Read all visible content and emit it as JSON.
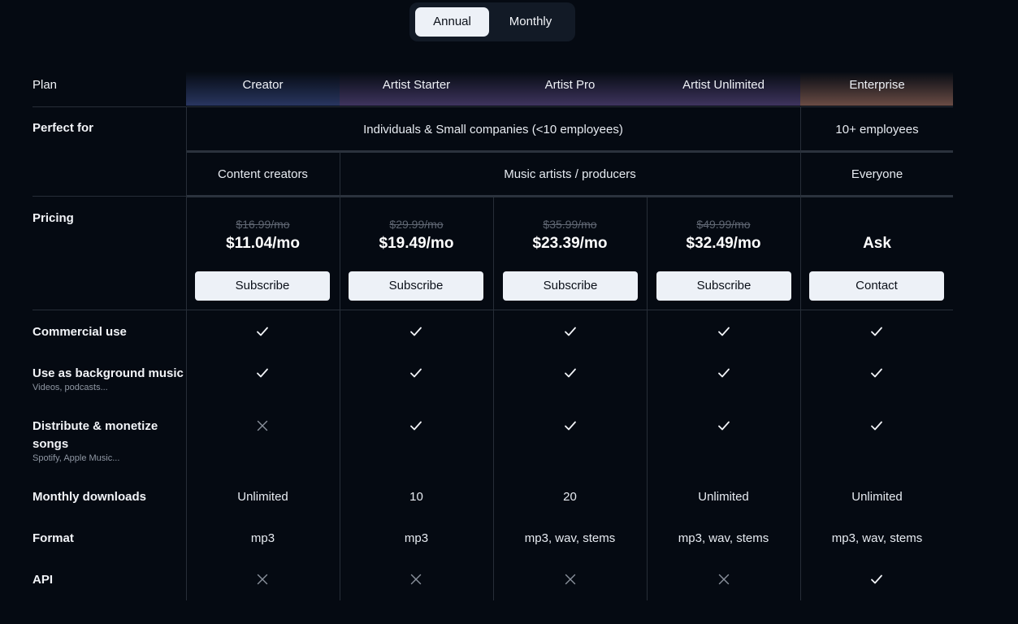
{
  "billing_toggle": {
    "annual": "Annual",
    "monthly": "Monthly",
    "selected": "Annual"
  },
  "labels": {
    "plan": "Plan",
    "perfect_for": "Perfect for",
    "pricing": "Pricing",
    "commercial_use": "Commercial use",
    "background_music": "Use as background music",
    "background_music_sub": "Videos, podcasts...",
    "distribute_line1": "Distribute & monetize",
    "distribute_line2": "songs",
    "distribute_sub": "Spotify, Apple Music...",
    "monthly_downloads": "Monthly downloads",
    "format": "Format",
    "api": "API"
  },
  "plans": [
    {
      "name": "Creator",
      "old_price": "$16.99/mo",
      "price": "$11.04/mo",
      "cta": "Subscribe",
      "downloads": "Unlimited",
      "format": "mp3"
    },
    {
      "name": "Artist Starter",
      "old_price": "$29.99/mo",
      "price": "$19.49/mo",
      "cta": "Subscribe",
      "downloads": "10",
      "format": "mp3"
    },
    {
      "name": "Artist Pro",
      "old_price": "$35.99/mo",
      "price": "$23.39/mo",
      "cta": "Subscribe",
      "downloads": "20",
      "format": "mp3, wav, stems"
    },
    {
      "name": "Artist Unlimited",
      "old_price": "$49.99/mo",
      "price": "$32.49/mo",
      "cta": "Subscribe",
      "downloads": "Unlimited",
      "format": "mp3, wav, stems"
    },
    {
      "name": "Enterprise",
      "old_price": "",
      "price": "Ask",
      "cta": "Contact",
      "downloads": "Unlimited",
      "format": "mp3, wav, stems"
    }
  ],
  "perfect_for": {
    "audience_small": "Individuals & Small companies (<10 employees)",
    "audience_large": "10+ employees",
    "creator_segment": "Content creators",
    "artist_segment": "Music artists / producers",
    "enterprise_segment": "Everyone"
  },
  "features": {
    "commercial_use": [
      true,
      true,
      true,
      true,
      true
    ],
    "background_music": [
      true,
      true,
      true,
      true,
      true
    ],
    "distribute": [
      false,
      true,
      true,
      true,
      true
    ],
    "api": [
      false,
      false,
      false,
      false,
      true
    ]
  },
  "colors": {
    "background": "#050a12",
    "button_bg": "#edf1f7",
    "line": "#272e38"
  }
}
